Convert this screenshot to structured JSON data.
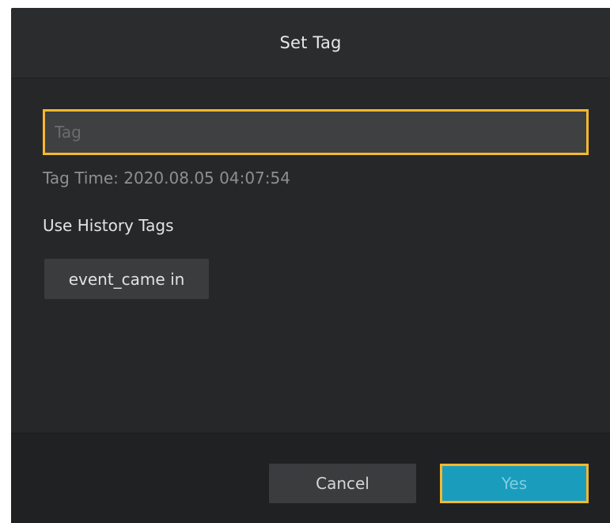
{
  "dialog": {
    "title": "Set Tag"
  },
  "tag_field": {
    "placeholder": "Tag",
    "value": ""
  },
  "tag_time": {
    "text": "Tag Time: 2020.08.05 04:07:54"
  },
  "history": {
    "label": "Use History Tags",
    "tags": [
      "event_came in"
    ]
  },
  "footer": {
    "cancel_label": "Cancel",
    "yes_label": "Yes"
  },
  "colors": {
    "focus_outline": "#f5b82e",
    "primary_button": "#1a9dbd",
    "dialog_background": "#2a2b2c"
  }
}
